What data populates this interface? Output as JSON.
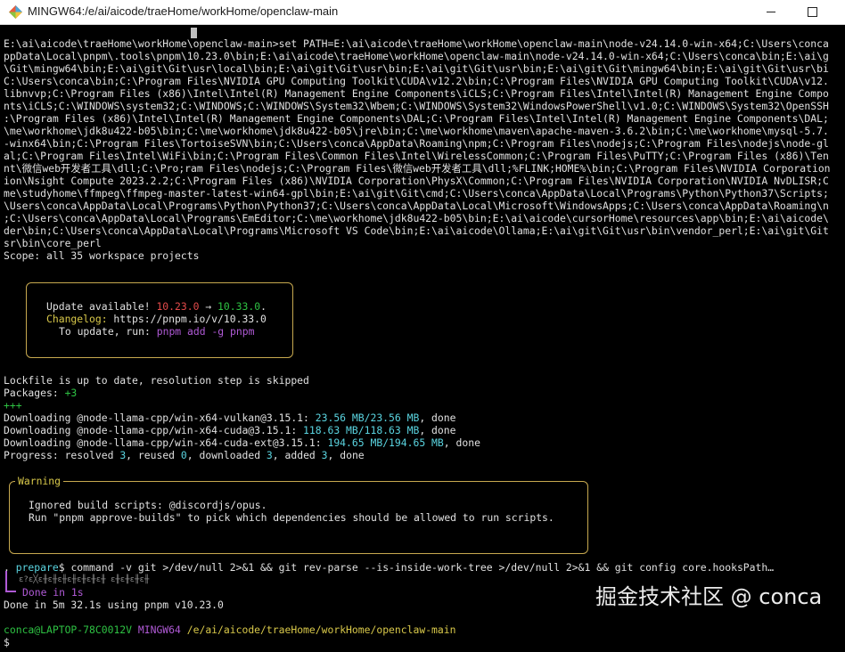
{
  "window": {
    "title": "MINGW64:/e/ai/aicode/traeHome/workHome/openclaw-main",
    "icon": "mingw-diamond-icon"
  },
  "terminal": {
    "path_lines": [
      "E:\\ai\\aicode\\traeHome\\workHome\\openclaw-main>set PATH=E:\\ai\\aicode\\traeHome\\workHome\\openclaw-main\\node-v24.14.0-win-x64;C:\\Users\\conca",
      "ppData\\Local\\pnpm\\.tools\\pnpm\\10.23.0\\bin;E:\\ai\\aicode\\traeHome\\workHome\\openclaw-main\\node-v24.14.0-win-x64;C:\\Users\\conca\\bin;E:\\ai\\g",
      "\\Git\\mingw64\\bin;E:\\ai\\git\\Git\\usr\\local\\bin;E:\\ai\\git\\Git\\usr\\bin;E:\\ai\\git\\Git\\usr\\bin;E:\\ai\\git\\Git\\mingw64\\bin;E:\\ai\\git\\Git\\usr\\bi",
      "C:\\Users\\conca\\bin;C:\\Program Files\\NVIDIA GPU Computing Toolkit\\CUDA\\v12.2\\bin;C:\\Program Files\\NVIDIA GPU Computing Toolkit\\CUDA\\v12.",
      "libnvvp;C:\\Program Files (x86)\\Intel\\Intel(R) Management Engine Components\\iCLS;C:\\Program Files\\Intel\\Intel(R) Management Engine Compo",
      "nts\\iCLS;C:\\WINDOWS\\system32;C:\\WINDOWS;C:\\WINDOWS\\System32\\Wbem;C:\\WINDOWS\\System32\\WindowsPowerShell\\v1.0;C:\\WINDOWS\\System32\\OpenSSH",
      ":\\Program Files (x86)\\Intel\\Intel(R) Management Engine Components\\DAL;C:\\Program Files\\Intel\\Intel(R) Management Engine Components\\DAL;",
      "\\me\\workhome\\jdk8u422-b05\\bin;C:\\me\\workhome\\jdk8u422-b05\\jre\\bin;C:\\me\\workhome\\maven\\apache-maven-3.6.2\\bin;C:\\me\\workhome\\mysql-5.7.",
      "-winx64\\bin;C:\\Program Files\\TortoiseSVN\\bin;C:\\Users\\conca\\AppData\\Roaming\\npm;C:\\Program Files\\nodejs;C:\\Program Files\\nodejs\\node-gl",
      "al;C:\\Program Files\\Intel\\WiFi\\bin;C:\\Program Files\\Common Files\\Intel\\WirelessCommon;C:\\Program Files\\PuTTY;C:\\Program Files (x86)\\Ten",
      "nt\\微信web开发者工具\\dll;C:\\Pro;ram Files\\nodejs;C:\\Program Files\\微信web开发者工具\\dll;%FLINK;HOME%\\bin;C:\\Program Files\\NVIDIA Corporation",
      "ion\\Nsight Compute 2023.2.2;C:\\Program Files (x86)\\NVIDIA Corporation\\PhysX\\Common;C:\\Program Files\\NVIDIA Corporation\\NVIDIA NvDLISR;C",
      "me\\studyhome\\ffmpeg\\ffmpeg-master-latest-win64-gpl\\bin;E:\\ai\\git\\Git\\cmd;C:\\Users\\conca\\AppData\\Local\\Programs\\Python\\Python37\\Scripts;",
      "\\Users\\conca\\AppData\\Local\\Programs\\Python\\Python37;C:\\Users\\conca\\AppData\\Local\\Microsoft\\WindowsApps;C:\\Users\\conca\\AppData\\Roaming\\n",
      ";C:\\Users\\conca\\AppData\\Local\\Programs\\EmEditor;C:\\me\\workhome\\jdk8u422-b05\\bin;E:\\ai\\aicode\\cursorHome\\resources\\app\\bin;E:\\ai\\aicode\\",
      "der\\bin;C:\\Users\\conca\\AppData\\Local\\Programs\\Microsoft VS Code\\bin;E:\\ai\\aicode\\Ollama;E:\\ai\\git\\Git\\usr\\bin\\vendor_perl;E:\\ai\\git\\Git",
      "sr\\bin\\core_perl"
    ],
    "scope": "Scope: all 35 workspace projects",
    "update_box": {
      "prefix": "Update available! ",
      "old_version": "10.23.0",
      "arrow": " → ",
      "new_version": "10.33.0",
      "suffix": ".",
      "changelog_label": "Changelog:",
      "changelog_url": " https://pnpm.io/v/10.33.0",
      "update_prefix": "To update, run: ",
      "update_cmd": "pnpm add -g pnpm"
    },
    "lockfile": "Lockfile is up to date, resolution step is skipped",
    "packages_label": "Packages: ",
    "packages_count": "+3",
    "plus_line": "+++",
    "downloads": [
      {
        "prefix": "Downloading @node-llama-cpp/win-x64-vulkan@3.15.1: ",
        "size": "23.56 MB/23.56 MB",
        "suffix": ", done"
      },
      {
        "prefix": "Downloading @node-llama-cpp/win-x64-cuda@3.15.1: ",
        "size": "118.63 MB/118.63 MB",
        "suffix": ", done"
      },
      {
        "prefix": "Downloading @node-llama-cpp/win-x64-cuda-ext@3.15.1: ",
        "size": "194.65 MB/194.65 MB",
        "suffix": ", done"
      }
    ],
    "progress": {
      "label": "Progress: resolved ",
      "resolved": "3",
      "reused_label": ", reused ",
      "reused": "0",
      "downloaded_label": ", downloaded ",
      "downloaded": "3",
      "added_label": ", added ",
      "added": "3",
      "done": ", done"
    },
    "warning_box": {
      "title": "Warning",
      "line1": "Ignored build scripts: @discordjs/opus.",
      "line2": "Run \"pnpm approve-builds\" to pick which dependencies should be allowed to run scripts."
    },
    "prepare": {
      "dot": ".",
      "name": " prepare",
      "cmd": "$ command -v git >/dev/null 2>&1 && git rev-parse --is-inside-work-tree >/dev/null 2>&1 && git config core.hooksPath…",
      "garbled": "ε?ε╳ε╫ε╫ε╫ε╫ε╫ε╫ε╫ ε╫ε╫ε╫ε╫",
      "done": "Done in 1s"
    },
    "done_line": "Done in 5m 32.1s using pnpm v10.23.0",
    "prompt": {
      "user": "conca@LAPTOP-78C0012V",
      "shell": "MINGW64",
      "path": "/e/ai/aicode/traeHome/workHome/openclaw-main",
      "symbol": "$"
    }
  },
  "watermark": "掘金技术社区 @ conca",
  "colors": {
    "background": "#000000",
    "text": "#e0e0e0",
    "cyan": "#5ad4e0",
    "green": "#2ec243",
    "yellow": "#d8c84a",
    "red": "#e24a4a",
    "purple": "#b05ad6",
    "box_border": "#c7a94f"
  }
}
